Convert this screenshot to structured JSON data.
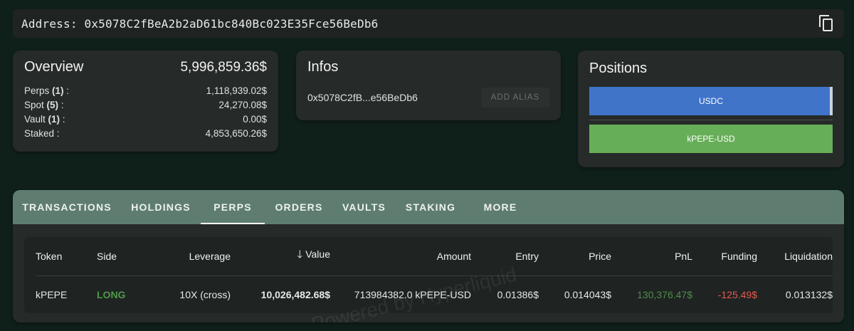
{
  "address_bar": {
    "label": "Address:",
    "address": "0x5078C2fBeA2b2aD61bc840Bc023E35Fce56BeDb6",
    "copy_icon": "copy-icon"
  },
  "overview": {
    "title": "Overview",
    "total": "5,996,859.36$",
    "rows": [
      {
        "label": "Perps",
        "count": "(1)",
        "suffix": " :",
        "value": "1,118,939.02$"
      },
      {
        "label": "Spot",
        "count": "(5)",
        "suffix": " :",
        "value": "24,270.08$"
      },
      {
        "label": "Vault",
        "count": "(1)",
        "suffix": " :",
        "value": "0.00$"
      },
      {
        "label": "Staked",
        "count": "",
        "suffix": " :",
        "value": "4,853,650.26$"
      }
    ]
  },
  "infos": {
    "title": "Infos",
    "short_address": "0x5078C2fB...e56BeDb6",
    "alias_button": "ADD ALIAS"
  },
  "positions": {
    "title": "Positions",
    "bars": [
      {
        "label": "USDC",
        "color": "#3f74c9"
      },
      {
        "label": "kPEPE-USD",
        "color": "#67ae58"
      }
    ]
  },
  "tabs": [
    "TRANSACTIONS",
    "HOLDINGS",
    "PERPS",
    "ORDERS",
    "VAULTS",
    "STAKING",
    "MORE"
  ],
  "active_tab": "PERPS",
  "table": {
    "watermark": "Powered by Hyperliquid",
    "headers": [
      "Token",
      "Side",
      "Leverage",
      "Value",
      "Amount",
      "Entry",
      "Price",
      "PnL",
      "Funding",
      "Liquidation"
    ],
    "sort_icon": "arrow-down-icon",
    "rows": [
      {
        "token": "kPEPE",
        "side": "LONG",
        "leverage": "10X (cross)",
        "value": "10,026,482.68$",
        "amount": "713984382.0 kPEPE-USD",
        "entry": "0.01386$",
        "price": "0.014043$",
        "pnl": "130,376.47$",
        "funding": "-125.49$",
        "liquidation": "0.013132$"
      }
    ]
  },
  "colors": {
    "background": "#0f1f1a",
    "card": "#262a29",
    "tab_bar": "#5e7d70",
    "long": "#4f9a4a",
    "negative": "#e25b52"
  }
}
